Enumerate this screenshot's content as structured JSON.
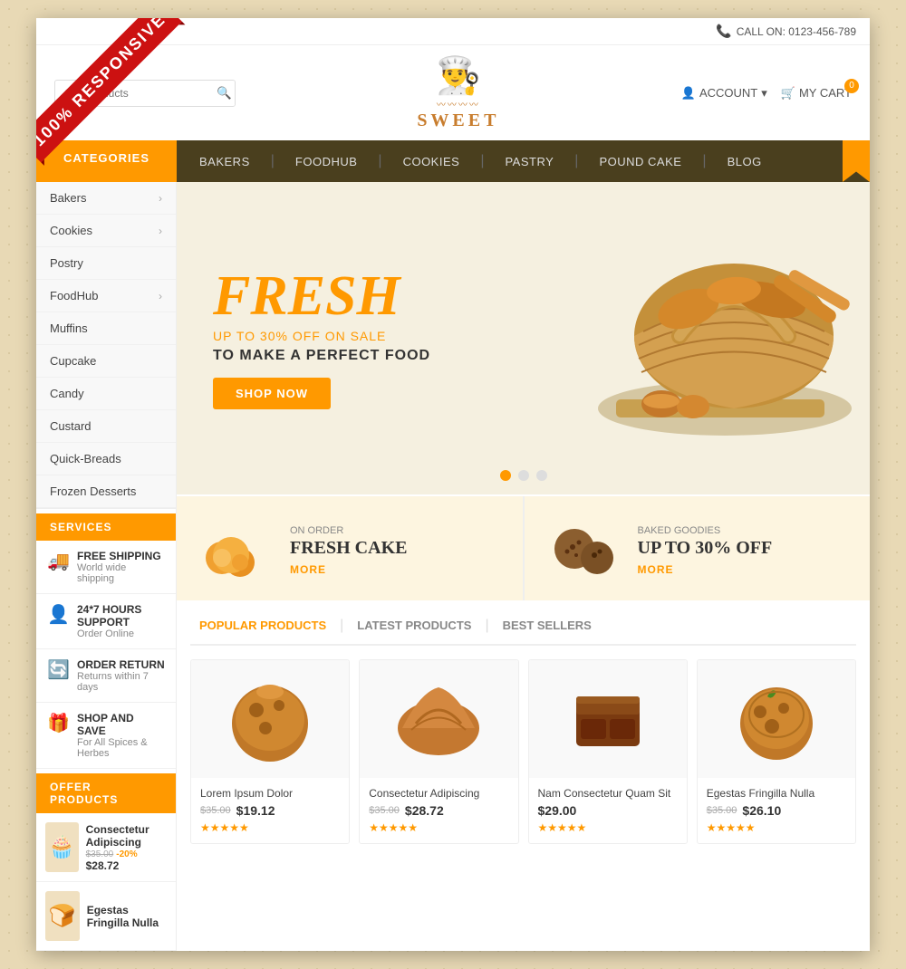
{
  "responsive_label": "100% RESPONSIVE",
  "top_bar": {
    "call_label": "CALL ON: 0123-456-789"
  },
  "header": {
    "search_placeholder": "Our Products",
    "logo_text": "SWEET",
    "account_label": "ACCOUNT",
    "cart_label": "MY CART",
    "cart_count": "0"
  },
  "nav": {
    "categories_label": "CATEGORIES",
    "links": [
      "BAKERS",
      "FOODHUB",
      "COOKIES",
      "PASTRY",
      "POUND CAKE",
      "BLOG"
    ]
  },
  "sidebar": {
    "categories": [
      {
        "name": "Bakers",
        "has_arrow": true
      },
      {
        "name": "Cookies",
        "has_arrow": true
      },
      {
        "name": "Postry",
        "has_arrow": false
      },
      {
        "name": "FoodHub",
        "has_arrow": true
      },
      {
        "name": "Muffins",
        "has_arrow": false
      },
      {
        "name": "Cupcake",
        "has_arrow": false
      },
      {
        "name": "Candy",
        "has_arrow": false
      },
      {
        "name": "Custard",
        "has_arrow": false
      },
      {
        "name": "Quick-Breads",
        "has_arrow": false
      },
      {
        "name": "Frozen Desserts",
        "has_arrow": false
      }
    ],
    "services_header": "SERVICES",
    "services": [
      {
        "icon": "🚚",
        "title": "FREE SHIPPING",
        "subtitle": "World wide shipping"
      },
      {
        "icon": "👤",
        "title": "24*7 HOURS SUPPORT",
        "subtitle": "Order Online"
      },
      {
        "icon": "🔄",
        "title": "ORDER RETURN",
        "subtitle": "Returns within 7 days"
      },
      {
        "icon": "🎁",
        "title": "SHOP AND SAVE",
        "subtitle": "For All Spices & Herbes"
      }
    ],
    "offer_header": "OFFER PRODUCTS",
    "offers": [
      {
        "name": "Consectetur Adipiscing",
        "old_price": "$35.00",
        "discount": "-20%",
        "new_price": "$28.72",
        "icon": "🧁"
      },
      {
        "name": "Egestas Fringilla Nulla",
        "old_price": "",
        "discount": "",
        "new_price": "",
        "icon": "🍞"
      }
    ]
  },
  "hero": {
    "title": "FRESH",
    "subtitle": "UP TO 30% OFF ON SALE",
    "description": "TO MAKE A PERFECT FOOD",
    "button_label": "SHOP NOW",
    "dots": [
      true,
      false,
      false
    ]
  },
  "promo": [
    {
      "label": "ON ORDER",
      "title": "FRESH CAKE",
      "more": "MORE",
      "icon": "🍮"
    },
    {
      "label": "BAKED GOODIES",
      "title": "UP TO 30% OFF",
      "more": "MORE",
      "icon": "🍪"
    }
  ],
  "products": {
    "tabs": [
      {
        "label": "POPULAR PRODUCTS",
        "active": true
      },
      {
        "label": "LATEST PRODUCTS",
        "active": false
      },
      {
        "label": "BEST SELLERS",
        "active": false
      }
    ],
    "items": [
      {
        "name": "Lorem Ipsum Dolor",
        "old_price": "$35.00",
        "new_price": "$19.12",
        "stars": "★★★★★",
        "icon": "🧁"
      },
      {
        "name": "Consectetur Adipiscing",
        "old_price": "$35.00",
        "new_price": "$28.72",
        "stars": "★★★★★",
        "icon": "🥐"
      },
      {
        "name": "Nam Consectetur Quam Sit",
        "old_price": "",
        "new_price": "$29.00",
        "stars": "★★★★★",
        "icon": "🍫"
      },
      {
        "name": "Egestas Fringilla Nulla",
        "old_price": "$35.00",
        "new_price": "$26.10",
        "stars": "★★★★★",
        "icon": "🧁"
      }
    ]
  }
}
